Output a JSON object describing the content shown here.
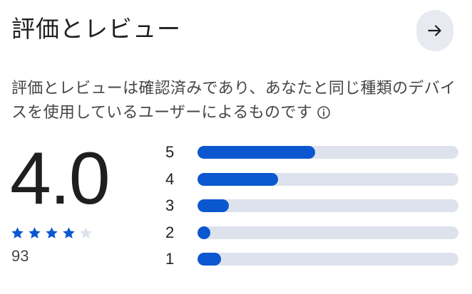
{
  "header": {
    "title": "評価とレビュー",
    "arrow_icon": "arrow-right-icon"
  },
  "description": {
    "text": "評価とレビューは確認済みであり、あなたと同じ種類のデバイスを使用しているユーザーによるものです",
    "info_icon": "info-icon"
  },
  "rating": {
    "score": "4.0",
    "stars_filled": 4,
    "stars_total": 5,
    "count": "93"
  },
  "distribution": [
    {
      "label": "5",
      "fraction": 0.45
    },
    {
      "label": "4",
      "fraction": 0.31
    },
    {
      "label": "3",
      "fraction": 0.12
    },
    {
      "label": "2",
      "fraction": 0.05
    },
    {
      "label": "1",
      "fraction": 0.09
    }
  ],
  "colors": {
    "accent": "#0b57d0",
    "track": "#dde2ec",
    "star_empty": "#dde2ec",
    "button_bg": "#e8eaf1"
  }
}
